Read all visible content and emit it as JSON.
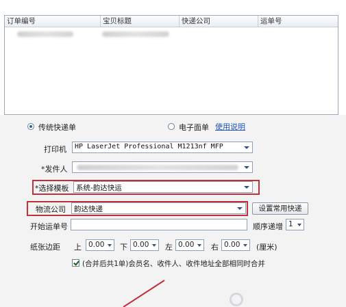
{
  "table": {
    "columns": [
      "订单编号",
      "宝贝标题",
      "快递公司",
      "运单号"
    ]
  },
  "options": {
    "traditional_label": "传统快递单",
    "electronic_label": "电子面单",
    "help_link": "使用说明"
  },
  "form": {
    "printer_label": "打印机",
    "printer_value": "HP LaserJet Professional M1213nf MFP",
    "sender_label": "*发件人",
    "template_label": "*选择模板",
    "template_value": "系统-韵达快运",
    "logistics_label": "物流公司",
    "logistics_value": "韵达快递",
    "set_common_button": "设置常用快递",
    "start_no_label": "开始运单号",
    "order_increment_label": "顺序递增",
    "order_increment_value": "1",
    "margin_label": "纸张边距",
    "top_label": "上",
    "top_value": "0.00",
    "bottom_label": "下",
    "bottom_value": "0.00",
    "left_label": "左",
    "left_value": "0.00",
    "right_label": "右",
    "right_value": "0.00",
    "unit_label": "(厘米)",
    "merge_label": "(合并后共1单)会员名、收件人、收件地址全部相同时合并"
  },
  "colors": {
    "highlight_border": "#c0303a",
    "link": "#1f55c2"
  }
}
